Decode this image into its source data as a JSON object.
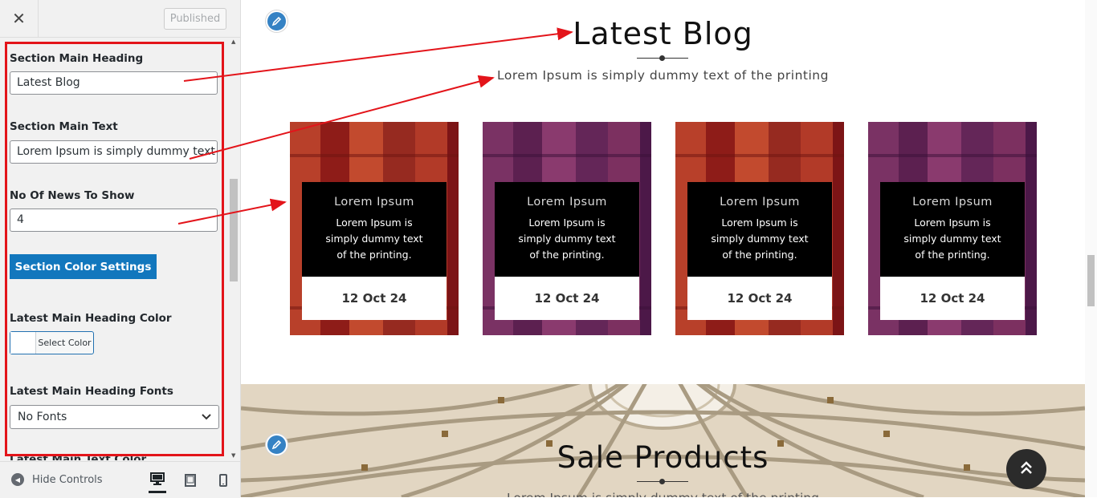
{
  "sidebar": {
    "close_icon": "close-icon",
    "publish_label": "Published",
    "fields": {
      "heading_label": "Section Main Heading",
      "heading_value": "Latest Blog",
      "text_label": "Section Main Text",
      "text_value": "Lorem Ipsum is simply dummy text of the printing",
      "count_label": "No Of News To Show",
      "count_value": "4",
      "color_settings_button": "Section Color Settings",
      "heading_color_label": "Latest Main Heading Color",
      "select_color": "Select Color",
      "heading_fonts_label": "Latest Main Heading Fonts",
      "fonts_value": "No Fonts",
      "next_label": "Latest Main Text Color"
    },
    "footer": {
      "hide_controls": "Hide Controls"
    }
  },
  "preview": {
    "blog": {
      "title": "Latest Blog",
      "subtitle": "Lorem Ipsum is simply dummy text of the printing",
      "cards": [
        {
          "title": "Lorem Ipsum",
          "text": "Lorem Ipsum is simply dummy text of the printing.",
          "date": "12 Oct 24"
        },
        {
          "title": "Lorem Ipsum",
          "text": "Lorem Ipsum is simply dummy text of the printing.",
          "date": "12 Oct 24"
        },
        {
          "title": "Lorem Ipsum",
          "text": "Lorem Ipsum is simply dummy text of the printing.",
          "date": "12 Oct 24"
        },
        {
          "title": "Lorem Ipsum",
          "text": "Lorem Ipsum is simply dummy text of the printing.",
          "date": "12 Oct 24"
        }
      ]
    },
    "sale": {
      "title": "Sale Products",
      "subtitle": "Lorem Ipsum is simply dummy text of the printing"
    }
  },
  "colors": {
    "highlight": "#e3141a",
    "button_blue": "#1277bd",
    "edit_blue": "#3582c4"
  }
}
